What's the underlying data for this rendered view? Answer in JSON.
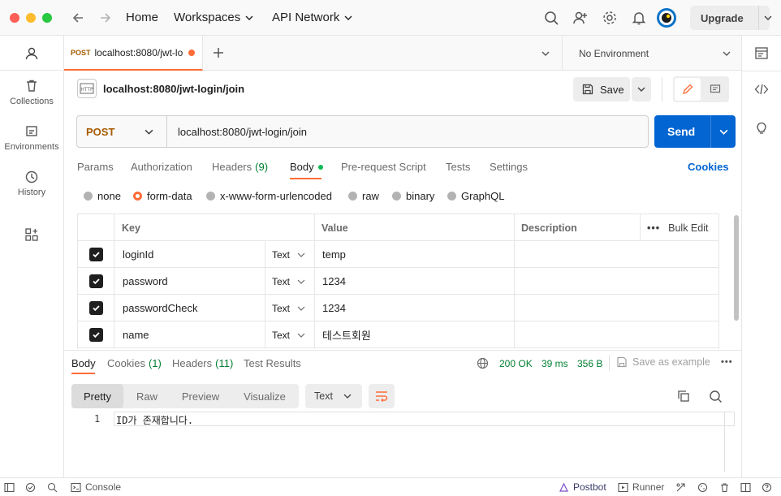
{
  "titlebar": {
    "home": "Home",
    "workspaces": "Workspaces",
    "api_network": "API Network",
    "upgrade": "Upgrade"
  },
  "sidebar": {
    "items": [
      {
        "label": "",
        "icon": "user-icon"
      },
      {
        "label": "Collections",
        "icon": "trash-can-icon"
      },
      {
        "label": "Environments",
        "icon": "environment-icon"
      },
      {
        "label": "History",
        "icon": "history-icon"
      },
      {
        "label": "",
        "icon": "apps-grid-icon"
      }
    ]
  },
  "tabs": {
    "active": {
      "method": "POST",
      "title": "localhost:8080/jwt-lo"
    },
    "environment": "No Environment"
  },
  "request": {
    "name": "localhost:8080/jwt-login/join",
    "save": "Save",
    "method": "POST",
    "url": "localhost:8080/jwt-login/join",
    "send": "Send",
    "subtabs": [
      "Params",
      "Authorization",
      "Headers",
      "Body",
      "Pre-request Script",
      "Tests",
      "Settings"
    ],
    "headers_count": "(9)",
    "cookies": "Cookies",
    "body_types": [
      "none",
      "form-data",
      "x-www-form-urlencoded",
      "raw",
      "binary",
      "GraphQL"
    ],
    "body_selected": "form-data",
    "table_headers": {
      "key": "Key",
      "value": "Value",
      "description": "Description",
      "bulk_edit": "Bulk Edit"
    },
    "rows": [
      {
        "key": "loginId",
        "type": "Text",
        "value": "temp",
        "description": ""
      },
      {
        "key": "password",
        "type": "Text",
        "value": "1234",
        "description": ""
      },
      {
        "key": "passwordCheck",
        "type": "Text",
        "value": "1234",
        "description": ""
      },
      {
        "key": "name",
        "type": "Text",
        "value": "테스트회원",
        "description": ""
      }
    ]
  },
  "response": {
    "tabs": {
      "body": "Body",
      "cookies": "Cookies",
      "cookies_count": "(1)",
      "headers": "Headers",
      "headers_count": "(11)",
      "test_results": "Test Results"
    },
    "status": "200 OK",
    "time": "39 ms",
    "size": "356 B",
    "save_example": "Save as example",
    "views": [
      "Pretty",
      "Raw",
      "Preview",
      "Visualize"
    ],
    "format": "Text",
    "line_number": "1",
    "code_line": "ID가 존재합니다."
  },
  "statusbar": {
    "console": "Console",
    "postbot": "Postbot",
    "runner": "Runner"
  },
  "colors": {
    "accent": "#ff6c37",
    "send": "#0265d2",
    "method": "#a65b00",
    "status_ok": "#007f31"
  }
}
